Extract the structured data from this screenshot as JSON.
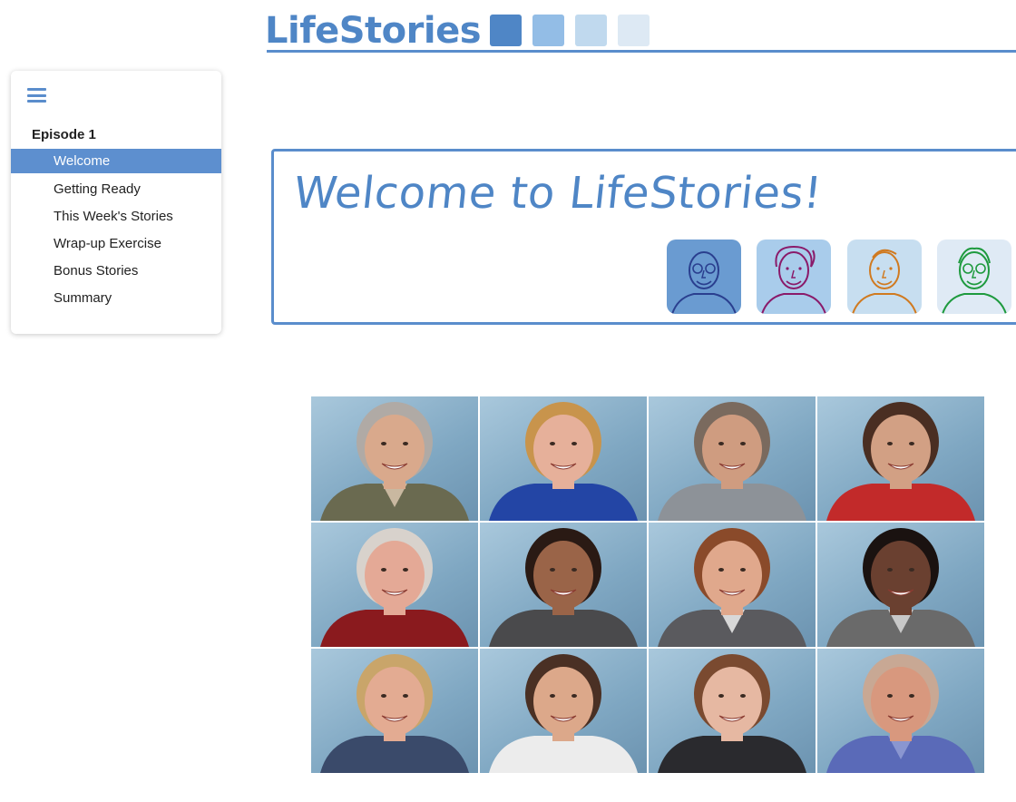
{
  "header": {
    "logo_text": "LifeStories",
    "logo_square_colors": [
      "#4f86c6",
      "#93bde6",
      "#c0d9ee",
      "#dde9f4"
    ],
    "accent": "#5a8dcc"
  },
  "sidebar": {
    "menu_icon": "hamburger-menu-icon",
    "episode_title": "Episode 1",
    "items": [
      {
        "label": "Welcome",
        "active": true
      },
      {
        "label": "Getting Ready",
        "active": false
      },
      {
        "label": "This Week's Stories",
        "active": false
      },
      {
        "label": "Wrap-up Exercise",
        "active": false
      },
      {
        "label": "Bonus Stories",
        "active": false
      },
      {
        "label": "Summary",
        "active": false
      }
    ]
  },
  "banner": {
    "title": "Welcome to LifeStories!",
    "avatars": [
      {
        "name": "illustrated-face-bald-glasses",
        "bg": "#6a9bd1",
        "line": "#2a3f8f"
      },
      {
        "name": "illustrated-face-curly-hair",
        "bg": "#a9cceb",
        "line": "#8a1a6a"
      },
      {
        "name": "illustrated-face-profile",
        "bg": "#c7def0",
        "line": "#d07a20"
      },
      {
        "name": "illustrated-face-glasses-smile",
        "bg": "#dfeaf5",
        "line": "#1e9a3e"
      }
    ]
  },
  "photos": [
    {
      "name": "photo-woman-gray-hair-glasses",
      "skin": "#d9a98c",
      "hair": "#b0aaa5",
      "shirt": "#6a6a50",
      "shirt2": "#c9b8a0"
    },
    {
      "name": "photo-woman-curly-blonde",
      "skin": "#e6b09a",
      "hair": "#c8944c",
      "shirt": "#2345a5",
      "shirt2": "#2345a5"
    },
    {
      "name": "photo-man-smiling-gray",
      "skin": "#cf9c80",
      "hair": "#7a6a5e",
      "shirt": "#8d9298",
      "shirt2": "#8d9298"
    },
    {
      "name": "photo-woman-dark-hair-glasses",
      "skin": "#d2a084",
      "hair": "#4a2e22",
      "shirt": "#c22a2a",
      "shirt2": "#c22a2a"
    },
    {
      "name": "photo-man-white-hair-glasses",
      "skin": "#e4a996",
      "hair": "#d8d2cc",
      "shirt": "#8a1a1e",
      "shirt2": "#8a1a1e"
    },
    {
      "name": "photo-man-short-dark-hair",
      "skin": "#9a6448",
      "hair": "#2a1a14",
      "shirt": "#4a4a4c",
      "shirt2": "#4a4a4c"
    },
    {
      "name": "photo-woman-auburn-hair",
      "skin": "#e0a88c",
      "hair": "#8a4a2a",
      "shirt": "#5a5a5e",
      "shirt2": "#d8d8d8"
    },
    {
      "name": "photo-woman-dark-skin-glasses",
      "skin": "#6a4030",
      "hair": "#1a1210",
      "shirt": "#6a6a6a",
      "shirt2": "#c8c8c8"
    },
    {
      "name": "photo-woman-blonde-laughing",
      "skin": "#e3ab92",
      "hair": "#c9a56a",
      "shirt": "#3a4a6a",
      "shirt2": "#3a4a6a"
    },
    {
      "name": "photo-woman-brown-hair",
      "skin": "#dca88a",
      "hair": "#4a3024",
      "shirt": "#ececec",
      "shirt2": "#ececec"
    },
    {
      "name": "photo-woman-long-brown-glasses",
      "skin": "#e6b8a2",
      "hair": "#7a4a30",
      "shirt": "#2a2a2e",
      "shirt2": "#2a2a2e"
    },
    {
      "name": "photo-man-bald-mustache",
      "skin": "#d8987e",
      "hair": "#c8a894",
      "shirt": "#5a6ab8",
      "shirt2": "#8a96d0"
    }
  ]
}
